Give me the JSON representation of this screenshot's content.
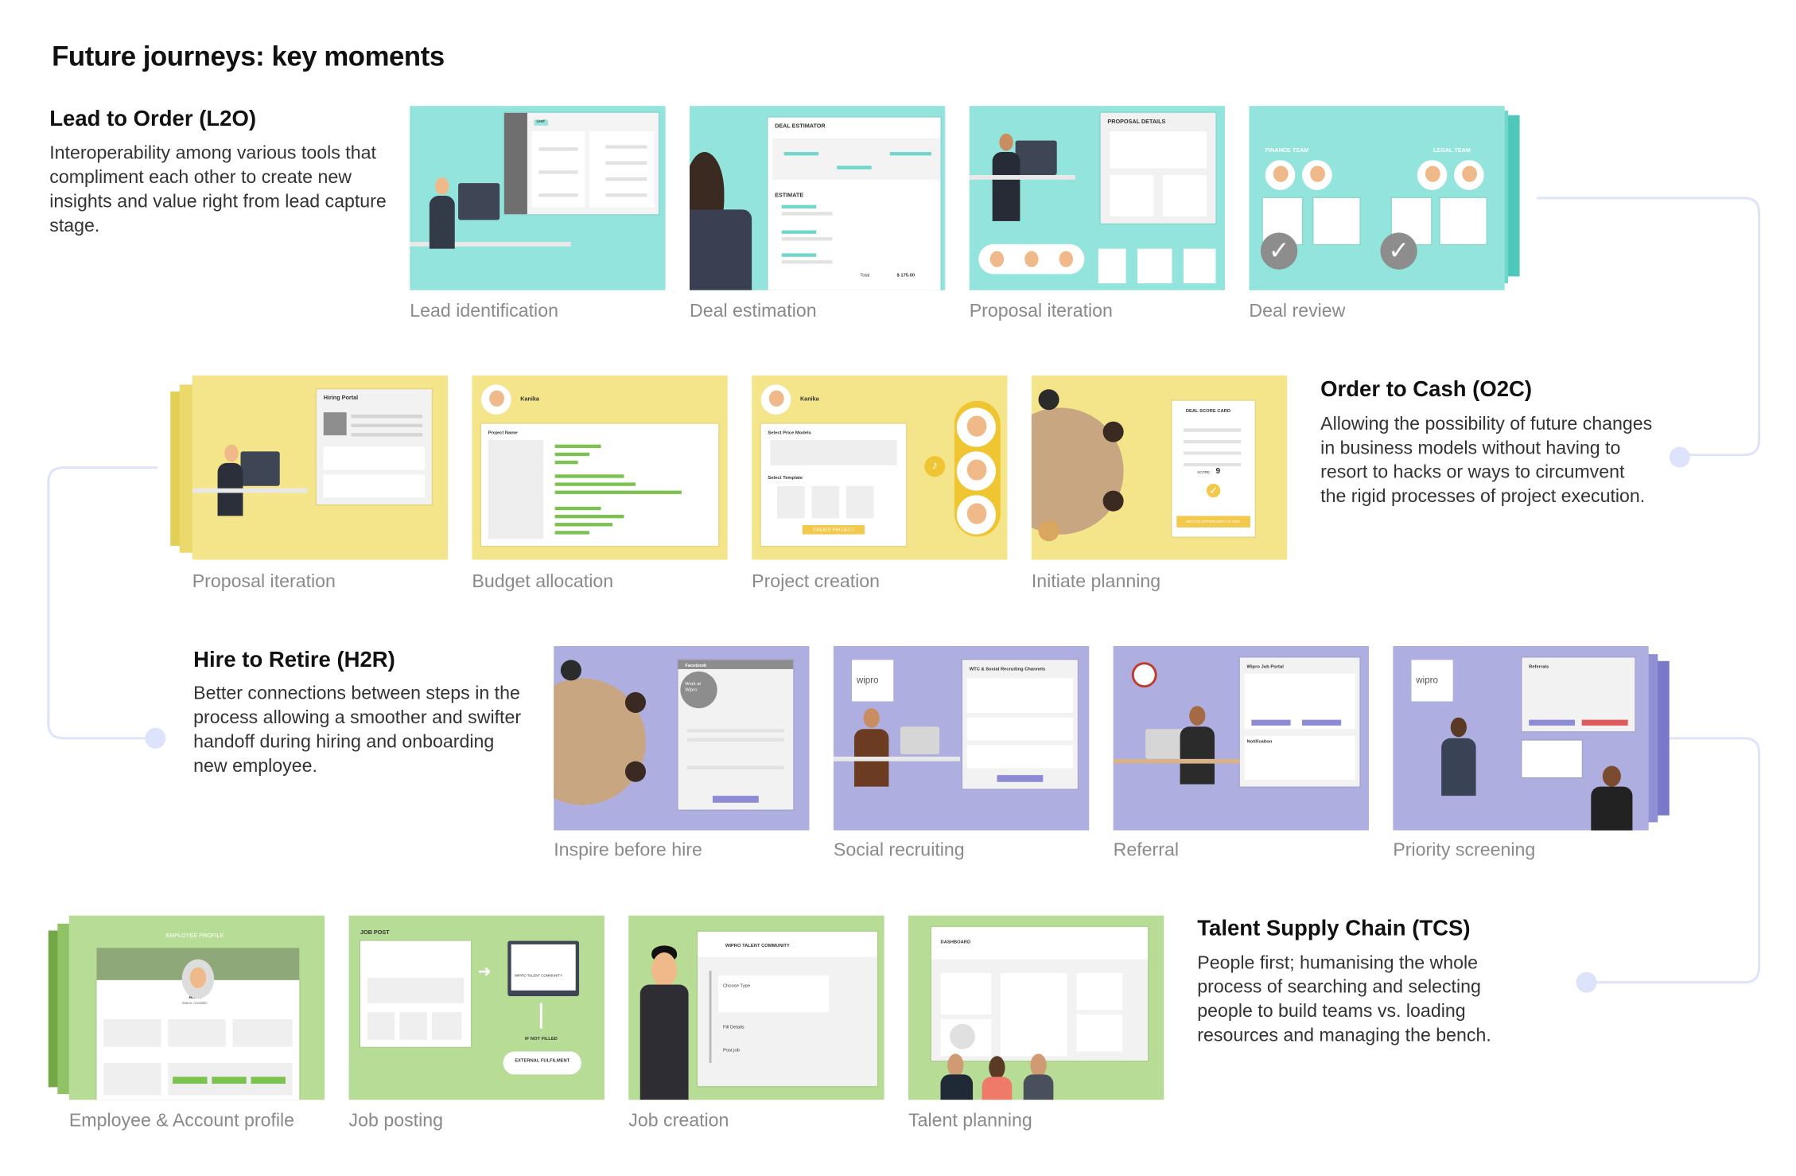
{
  "title": "Future journeys: key moments",
  "colors": {
    "teal": "#93E4DC",
    "yellow": "#F4E48A",
    "purple": "#AFAEE0",
    "green": "#B7DC95",
    "connector": "#DDE3FB",
    "label": "#8A8A8A"
  },
  "sections": [
    {
      "title": "Lead to Order (L2O)",
      "body": "Interoperability among various tools that compliment each other to create new insights and value right from lead capture stage.",
      "cards": [
        {
          "label": "Lead identification",
          "panel_title": "Lead"
        },
        {
          "label": "Deal estimation",
          "panel_title": "DEAL ESTIMATOR",
          "sub": "ESTIMATE",
          "total": "Total",
          "amount": "$ 175.00"
        },
        {
          "label": "Proposal iteration",
          "panel_title": "PROPOSAL DETAILS"
        },
        {
          "label": "Deal review",
          "left_team": "FINANCE TEAM",
          "right_team": "LEGAL TEAM"
        }
      ]
    },
    {
      "title": "Order to Cash (O2C)",
      "body": "Allowing the possibility of future changes in business models without having to resort to hacks or ways to circumvent the rigid processes of project execution.",
      "cards": [
        {
          "label": "Proposal iteration",
          "panel_title": "Hiring Portal"
        },
        {
          "label": "Budget allocation",
          "panel_title": "Kanika",
          "sub": "Project Name"
        },
        {
          "label": "Project creation",
          "panel_title": "Kanika",
          "sub": "Select Price Models",
          "sub2": "Select Template",
          "button": "CREATE PROJECT"
        },
        {
          "label": "Initiate planning",
          "panel_title": "DEAL SCORE CARD",
          "score_label": "SCORE :",
          "score": "9",
          "button": "INITIATE OPPORTUNITY AT RISK"
        }
      ]
    },
    {
      "title": "Hire to Retire (H2R)",
      "body": "Better connections between steps in the process allowing a smoother and swifter handoff during hiring and onboarding new employee.",
      "cards": [
        {
          "label": "Inspire before hire",
          "panel_title": "Facebook",
          "sub": "Work at Wipro"
        },
        {
          "label": "Social recruiting",
          "panel_title": "WTC & Social Recruiting Channels",
          "logo": "wipro"
        },
        {
          "label": "Referral",
          "panel_title": "Wipro Job Portal",
          "sub": "Notification"
        },
        {
          "label": "Priority screening",
          "panel_title": "Referrals",
          "logo": "wipro"
        }
      ]
    },
    {
      "title": "Talent Supply Chain (TCS)",
      "body": "People first; humanising the whole process of searching and selecting people to build teams vs. loading resources and managing the bench.",
      "cards": [
        {
          "label": "Employee & Account profile",
          "panel_title": "EMPLOYEE PROFILE",
          "name": "ARYA",
          "status": "Status: Available"
        },
        {
          "label": "Job posting",
          "panel_title": "JOB POST",
          "sub": "WIPRO TALENT COMMUNITY",
          "sub2": "IF NOT FILLED",
          "button": "EXTERNAL FULFILMENT"
        },
        {
          "label": "Job creation",
          "panel_title": "WIPRO TALENT COMMUNITY",
          "sub": "Choose Type",
          "sub2": "Fill Details",
          "sub3": "Post job"
        },
        {
          "label": "Talent planning",
          "panel_title": "DASHBOARD"
        }
      ]
    }
  ]
}
